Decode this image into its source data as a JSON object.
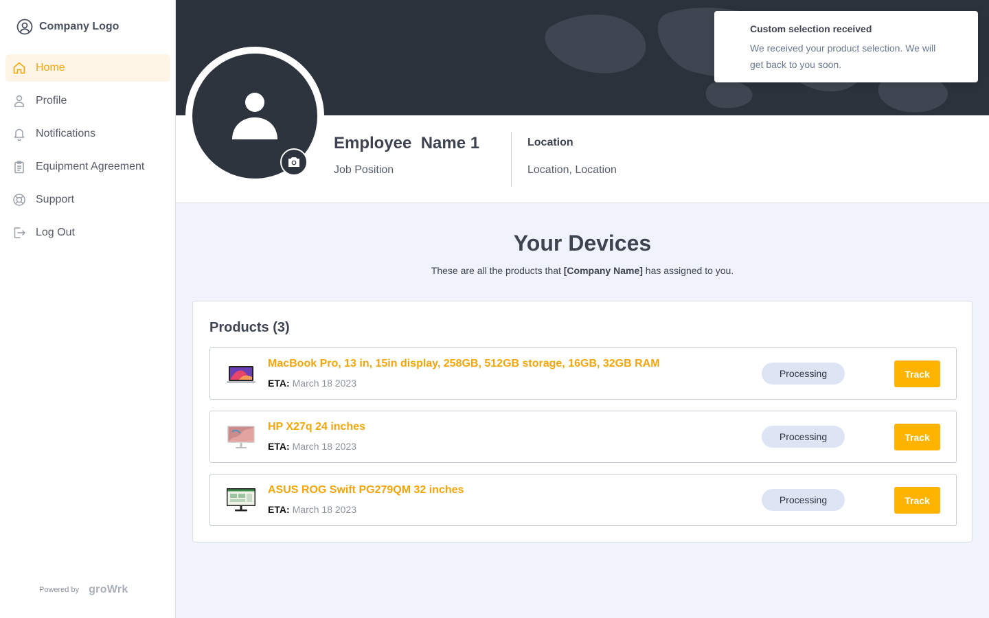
{
  "sidebar": {
    "logo_text": "Company Logo",
    "items": [
      {
        "label": "Home",
        "icon": "home-icon",
        "active": true
      },
      {
        "label": "Profile",
        "icon": "user-icon"
      },
      {
        "label": "Notifications",
        "icon": "bell-icon"
      },
      {
        "label": "Equipment Agreement",
        "icon": "clipboard-icon"
      },
      {
        "label": "Support",
        "icon": "lifebuoy-icon"
      },
      {
        "label": "Log Out",
        "icon": "logout-icon"
      }
    ],
    "powered_by": "Powered by",
    "brand": "groWrk"
  },
  "profile": {
    "name": "Employee  Name 1",
    "job_position": "Job Position",
    "location_title": "Location",
    "location_value": "Location, Location"
  },
  "toast": {
    "title": "Custom selection received",
    "body": "We received your product selection. We will get back to you soon."
  },
  "devices": {
    "title": "Your Devices",
    "subtitle_prefix": "These are all the products that ",
    "subtitle_company": "[Company Name]",
    "subtitle_suffix": " has assigned to you.",
    "products_heading": "Products (3)",
    "products": [
      {
        "name": "MacBook Pro, 13 in, 15in display, 258GB, 512GB storage, 16GB, 32GB RAM",
        "eta_label": "ETA:",
        "eta": "March 18 2023",
        "status": "Processing",
        "action": "Track"
      },
      {
        "name": "HP X27q 24 inches",
        "eta_label": "ETA:",
        "eta": "March 18 2023",
        "status": "Processing",
        "action": "Track"
      },
      {
        "name": "ASUS ROG Swift PG279QM 32 inches",
        "eta_label": "ETA:",
        "eta": "March 18 2023",
        "status": "Processing",
        "action": "Track"
      }
    ]
  },
  "colors": {
    "accent": "#f5a50a",
    "button": "#fdb300",
    "banner": "#2b323c",
    "status_bg": "#dde4f3",
    "page_bg": "#f0f3fb"
  }
}
